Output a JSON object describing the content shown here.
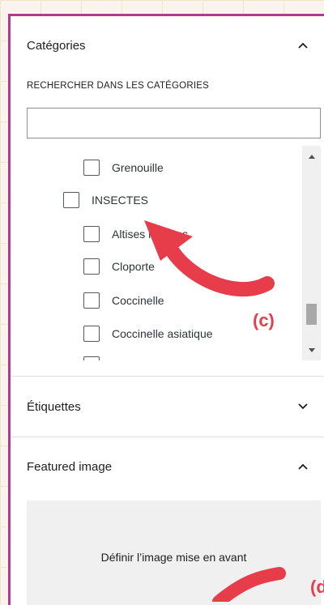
{
  "panels": {
    "categories": {
      "title": "Catégories",
      "search_label": "RECHERCHER DANS LES CATÉGORIES",
      "search_value": "",
      "items": [
        {
          "label": "Grenouille",
          "checked": false,
          "level": 2
        },
        {
          "label": "INSECTES",
          "checked": false,
          "level": 1
        },
        {
          "label": "Altises mauves",
          "checked": false,
          "level": 2
        },
        {
          "label": "Cloporte",
          "checked": false,
          "level": 2
        },
        {
          "label": "Coccinelle",
          "checked": false,
          "level": 2
        },
        {
          "label": "Coccinelle asiatique",
          "checked": false,
          "level": 2
        }
      ]
    },
    "tags": {
      "title": "Étiquettes"
    },
    "featured": {
      "title": "Featured image",
      "button": "Définir l’image mise en avant"
    }
  },
  "annotations": {
    "c": "(c)",
    "d": "(d"
  },
  "colors": {
    "border": "#b23a8c",
    "annotation": "#e73c4a"
  },
  "icons": {
    "categories_toggle": "chevron-up-icon",
    "tags_toggle": "chevron-down-icon",
    "featured_toggle": "chevron-up-icon"
  }
}
